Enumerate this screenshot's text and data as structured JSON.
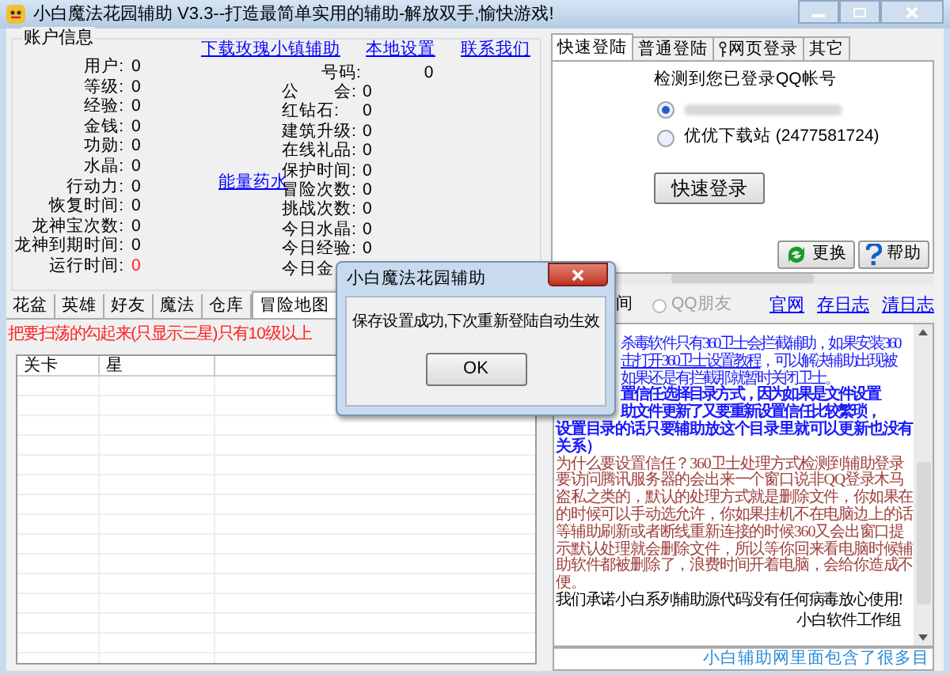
{
  "window": {
    "title": "小白魔法花园辅助 V3.3--打造最简单实用的辅助-解放双手,愉快游戏!"
  },
  "account": {
    "legend": "账户信息",
    "links": [
      "下载玫瑰小镇辅助",
      "本地设置",
      "联系我们"
    ],
    "left_fields": [
      {
        "label": "用户:",
        "value": "0",
        "alert": false
      },
      {
        "label": "等级:",
        "value": "0",
        "alert": false
      },
      {
        "label": "经验:",
        "value": "0",
        "alert": false
      },
      {
        "label": "金钱:",
        "value": "0",
        "alert": false
      },
      {
        "label": "功勋:",
        "value": "0",
        "alert": false
      },
      {
        "label": "水晶:",
        "value": "0",
        "alert": false
      },
      {
        "label": "行动力:",
        "value": "0",
        "alert": false
      },
      {
        "label": "恢复时间:",
        "value": "0",
        "alert": false
      },
      {
        "label": "龙神宝次数:",
        "value": "0",
        "alert": false
      },
      {
        "label": "龙神到期时间:",
        "value": "0",
        "alert": false
      },
      {
        "label": "运行时间:",
        "value": "0",
        "alert": true
      }
    ],
    "potion_link": "能量药水",
    "number_field": {
      "label": "号码:",
      "value": "0"
    },
    "right_fields": [
      {
        "label": "公　　会:",
        "value": "0"
      },
      {
        "label": "红钻石:",
        "value": "0"
      },
      {
        "label": "建筑升级:",
        "value": "0"
      },
      {
        "label": "在线礼品:",
        "value": "0"
      },
      {
        "label": "保护时间:",
        "value": "0"
      },
      {
        "label": "冒险次数:",
        "value": "0"
      },
      {
        "label": "挑战次数:",
        "value": "0"
      },
      {
        "label": "今日水晶:",
        "value": "0"
      },
      {
        "label": "今日经验:",
        "value": "0"
      },
      {
        "label": "今日金"
      }
    ]
  },
  "left_tabs": [
    {
      "label": "花盆",
      "selected": false
    },
    {
      "label": "英雄",
      "selected": false
    },
    {
      "label": "好友",
      "selected": false
    },
    {
      "label": "魔法",
      "selected": false
    },
    {
      "label": "仓库",
      "selected": false
    },
    {
      "label": "冒险地图",
      "selected": true
    }
  ],
  "notice": "把要扫荡的勾起来(只显示三星)只有10级以上",
  "table": {
    "columns": [
      "关卡",
      "星"
    ]
  },
  "login": {
    "tabs": [
      {
        "label": "快速登陆",
        "selected": true,
        "icon": false
      },
      {
        "label": "普通登陆",
        "selected": false,
        "icon": false
      },
      {
        "label": "网页登录",
        "selected": false,
        "icon": true
      },
      {
        "label": "其它",
        "selected": false,
        "icon": false
      }
    ],
    "heading": "检测到您已登录QQ帐号",
    "accounts": [
      {
        "selected": true,
        "blurred": true
      },
      {
        "label": "优优下载站 (2477581724)",
        "selected": false,
        "blurred": false
      }
    ],
    "login_button": "快速登录",
    "buttons": [
      {
        "label": "更换",
        "kind": "refresh"
      },
      {
        "label": "帮助",
        "kind": "help"
      }
    ]
  },
  "log_bar": {
    "fragment": "间",
    "radio": {
      "label": "QQ朋友",
      "disabled": true,
      "selected": false
    },
    "links": [
      "官网",
      "存日志",
      "清日志"
    ]
  },
  "log": {
    "lines": [
      {
        "kind": "blue",
        "covered": true,
        "segments": [
          {
            "text": "杀毒软件只有360卫士会拦截辅助，如果安装360",
            "link": false
          }
        ]
      },
      {
        "kind": "blue",
        "covered": true,
        "segments": [
          {
            "text": "击打开360卫士设置教程",
            "link": true
          },
          {
            "text": "，可以解决辅助出现被",
            "link": false
          }
        ]
      },
      {
        "kind": "blue",
        "covered": true,
        "segments": [
          {
            "text": "如果还是有拦截那就暂时关闭卫士。",
            "link": false
          }
        ]
      },
      {
        "kind": "bold",
        "covered": true,
        "segments": [
          {
            "text": "置信任选择目录方式，因为如果是文件设置",
            "link": false
          }
        ]
      },
      {
        "kind": "bold",
        "covered": true,
        "segments": [
          {
            "text": "助文件更新了又要重新设置信任比较繁琐，",
            "link": false
          }
        ]
      },
      {
        "kind": "bold",
        "covered": false,
        "segments": [
          {
            "text": "设置目录的话只要辅助放这个目录里就可以更新也没有关系）",
            "link": false
          }
        ]
      },
      {
        "kind": "brown",
        "covered": false,
        "segments": [
          {
            "text": "为什么要设置信任？360卫士处理方式检测到辅助登录要访问腾讯服务器的会出来一个窗口说非QQ登录木马盗私之类的，默认的处理方式就是删除文件，你如果在的时候可以手动选允许，你如果挂机不在电脑边上的话等辅助刷新或者断线重新连接的时候360又会出窗口提示默认处理就会删除文件，所以等你回来看电脑时候辅助软件都被删除了，浪费时间开着电脑，会给你造成不便。",
            "link": false
          }
        ]
      },
      {
        "kind": "black",
        "covered": false,
        "segments": [
          {
            "text": "我们承诺小白系列辅助源代码没有任何病毒放心使用!",
            "link": false
          }
        ]
      }
    ],
    "signature": "小白软件工作组",
    "input_value": "小白辅助网里面包含了很多目"
  },
  "dialog": {
    "title": "小白魔法花园辅助",
    "message": "保存设置成功,下次重新登陆自动生效",
    "button": "OK"
  }
}
